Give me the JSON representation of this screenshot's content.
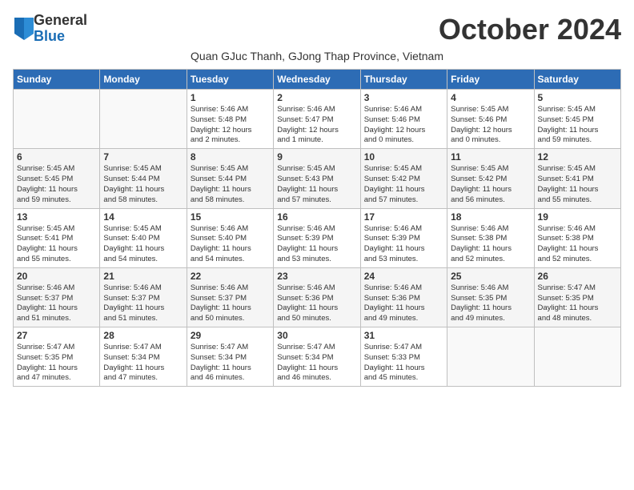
{
  "logo": {
    "general": "General",
    "blue": "Blue"
  },
  "title": "October 2024",
  "subtitle": "Quan GJuc Thanh, GJong Thap Province, Vietnam",
  "days_header": [
    "Sunday",
    "Monday",
    "Tuesday",
    "Wednesday",
    "Thursday",
    "Friday",
    "Saturday"
  ],
  "weeks": [
    [
      {
        "day": "",
        "info": ""
      },
      {
        "day": "",
        "info": ""
      },
      {
        "day": "1",
        "info": "Sunrise: 5:46 AM\nSunset: 5:48 PM\nDaylight: 12 hours\nand 2 minutes."
      },
      {
        "day": "2",
        "info": "Sunrise: 5:46 AM\nSunset: 5:47 PM\nDaylight: 12 hours\nand 1 minute."
      },
      {
        "day": "3",
        "info": "Sunrise: 5:46 AM\nSunset: 5:46 PM\nDaylight: 12 hours\nand 0 minutes."
      },
      {
        "day": "4",
        "info": "Sunrise: 5:45 AM\nSunset: 5:46 PM\nDaylight: 12 hours\nand 0 minutes."
      },
      {
        "day": "5",
        "info": "Sunrise: 5:45 AM\nSunset: 5:45 PM\nDaylight: 11 hours\nand 59 minutes."
      }
    ],
    [
      {
        "day": "6",
        "info": "Sunrise: 5:45 AM\nSunset: 5:45 PM\nDaylight: 11 hours\nand 59 minutes."
      },
      {
        "day": "7",
        "info": "Sunrise: 5:45 AM\nSunset: 5:44 PM\nDaylight: 11 hours\nand 58 minutes."
      },
      {
        "day": "8",
        "info": "Sunrise: 5:45 AM\nSunset: 5:44 PM\nDaylight: 11 hours\nand 58 minutes."
      },
      {
        "day": "9",
        "info": "Sunrise: 5:45 AM\nSunset: 5:43 PM\nDaylight: 11 hours\nand 57 minutes."
      },
      {
        "day": "10",
        "info": "Sunrise: 5:45 AM\nSunset: 5:42 PM\nDaylight: 11 hours\nand 57 minutes."
      },
      {
        "day": "11",
        "info": "Sunrise: 5:45 AM\nSunset: 5:42 PM\nDaylight: 11 hours\nand 56 minutes."
      },
      {
        "day": "12",
        "info": "Sunrise: 5:45 AM\nSunset: 5:41 PM\nDaylight: 11 hours\nand 55 minutes."
      }
    ],
    [
      {
        "day": "13",
        "info": "Sunrise: 5:45 AM\nSunset: 5:41 PM\nDaylight: 11 hours\nand 55 minutes."
      },
      {
        "day": "14",
        "info": "Sunrise: 5:45 AM\nSunset: 5:40 PM\nDaylight: 11 hours\nand 54 minutes."
      },
      {
        "day": "15",
        "info": "Sunrise: 5:46 AM\nSunset: 5:40 PM\nDaylight: 11 hours\nand 54 minutes."
      },
      {
        "day": "16",
        "info": "Sunrise: 5:46 AM\nSunset: 5:39 PM\nDaylight: 11 hours\nand 53 minutes."
      },
      {
        "day": "17",
        "info": "Sunrise: 5:46 AM\nSunset: 5:39 PM\nDaylight: 11 hours\nand 53 minutes."
      },
      {
        "day": "18",
        "info": "Sunrise: 5:46 AM\nSunset: 5:38 PM\nDaylight: 11 hours\nand 52 minutes."
      },
      {
        "day": "19",
        "info": "Sunrise: 5:46 AM\nSunset: 5:38 PM\nDaylight: 11 hours\nand 52 minutes."
      }
    ],
    [
      {
        "day": "20",
        "info": "Sunrise: 5:46 AM\nSunset: 5:37 PM\nDaylight: 11 hours\nand 51 minutes."
      },
      {
        "day": "21",
        "info": "Sunrise: 5:46 AM\nSunset: 5:37 PM\nDaylight: 11 hours\nand 51 minutes."
      },
      {
        "day": "22",
        "info": "Sunrise: 5:46 AM\nSunset: 5:37 PM\nDaylight: 11 hours\nand 50 minutes."
      },
      {
        "day": "23",
        "info": "Sunrise: 5:46 AM\nSunset: 5:36 PM\nDaylight: 11 hours\nand 50 minutes."
      },
      {
        "day": "24",
        "info": "Sunrise: 5:46 AM\nSunset: 5:36 PM\nDaylight: 11 hours\nand 49 minutes."
      },
      {
        "day": "25",
        "info": "Sunrise: 5:46 AM\nSunset: 5:35 PM\nDaylight: 11 hours\nand 49 minutes."
      },
      {
        "day": "26",
        "info": "Sunrise: 5:47 AM\nSunset: 5:35 PM\nDaylight: 11 hours\nand 48 minutes."
      }
    ],
    [
      {
        "day": "27",
        "info": "Sunrise: 5:47 AM\nSunset: 5:35 PM\nDaylight: 11 hours\nand 47 minutes."
      },
      {
        "day": "28",
        "info": "Sunrise: 5:47 AM\nSunset: 5:34 PM\nDaylight: 11 hours\nand 47 minutes."
      },
      {
        "day": "29",
        "info": "Sunrise: 5:47 AM\nSunset: 5:34 PM\nDaylight: 11 hours\nand 46 minutes."
      },
      {
        "day": "30",
        "info": "Sunrise: 5:47 AM\nSunset: 5:34 PM\nDaylight: 11 hours\nand 46 minutes."
      },
      {
        "day": "31",
        "info": "Sunrise: 5:47 AM\nSunset: 5:33 PM\nDaylight: 11 hours\nand 45 minutes."
      },
      {
        "day": "",
        "info": ""
      },
      {
        "day": "",
        "info": ""
      }
    ]
  ]
}
